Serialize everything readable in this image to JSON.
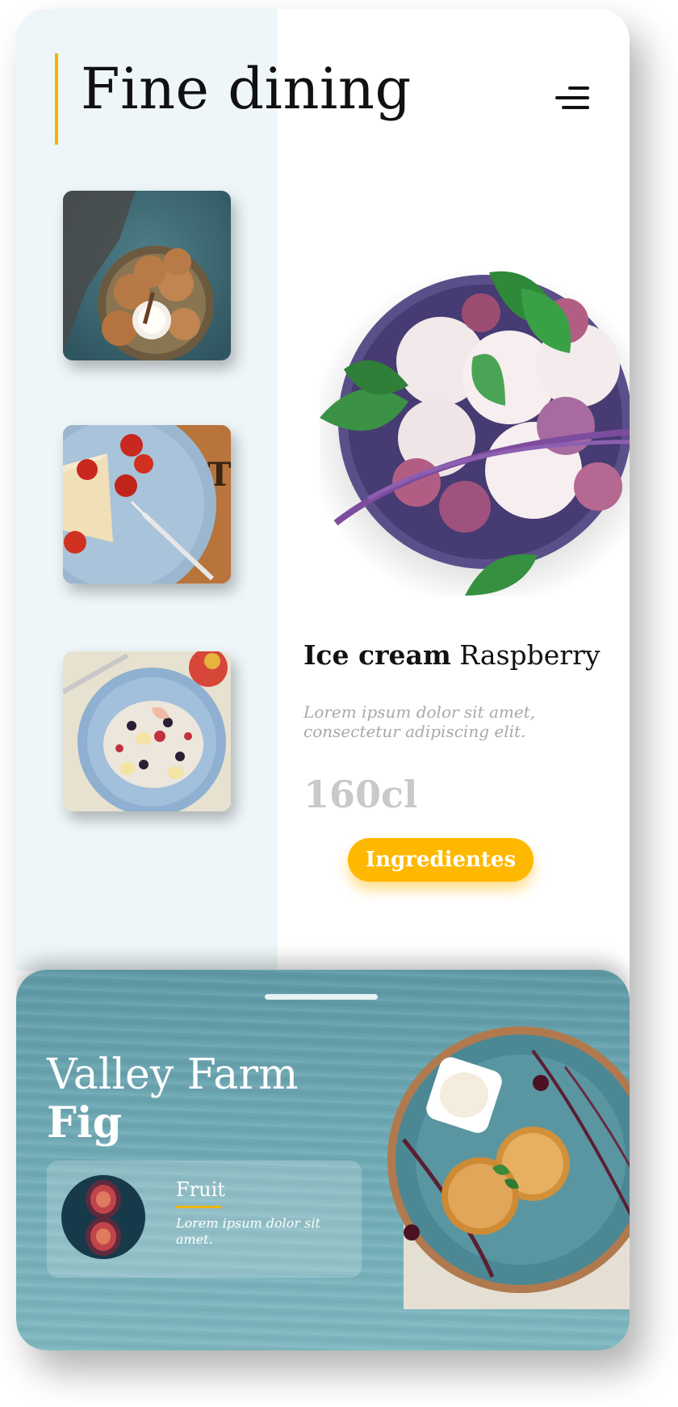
{
  "header": {
    "title": "Fine dining"
  },
  "menu": {
    "icon": "menu-icon"
  },
  "thumbnails": [
    {
      "name": "cookies-thumb"
    },
    {
      "name": "cheesecake-thumb"
    },
    {
      "name": "oatmeal-thumb"
    }
  ],
  "featured": {
    "name_bold": "Ice cream",
    "name_light": "Raspberry",
    "description": "Lorem ipsum dolor sit amet, consectetur adipiscing elit.",
    "volume": "160cl",
    "button_label": "Ingredientes"
  },
  "bottom_panel": {
    "title_line1": "Valley Farm",
    "title_line2": "Fig",
    "card": {
      "label": "Fruit",
      "description": "Lorem ipsum dolor sit amet."
    }
  },
  "colors": {
    "accent": "#f3b400",
    "button": "#ffb800",
    "left_panel": "#eef6f9",
    "bottom_panel": "#6ea9b4"
  }
}
